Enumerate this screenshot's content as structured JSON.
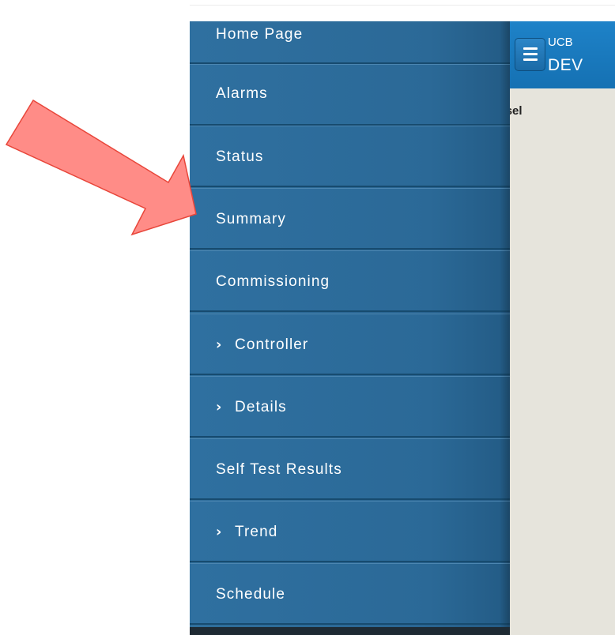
{
  "header": {
    "org_label": "UCB",
    "title": "DEV"
  },
  "content": {
    "prompt": "Please sel"
  },
  "sidebar": {
    "items": [
      {
        "label": "Home Page",
        "expandable": false
      },
      {
        "label": "Alarms",
        "expandable": false
      },
      {
        "label": "Status",
        "expandable": false
      },
      {
        "label": "Summary",
        "expandable": false
      },
      {
        "label": "Commissioning",
        "expandable": false
      },
      {
        "label": "Controller",
        "expandable": true
      },
      {
        "label": "Details",
        "expandable": true
      },
      {
        "label": "Self Test Results",
        "expandable": false
      },
      {
        "label": "Trend",
        "expandable": true
      },
      {
        "label": "Schedule",
        "expandable": false
      }
    ]
  },
  "annotation": {
    "arrow_color": "#ff8c87",
    "arrow_outline": "#e8463a",
    "target": "Summary"
  },
  "colors": {
    "sidebar": "#2b6997",
    "header": "#1b7bc0",
    "content_bg": "#e6e4dc"
  }
}
